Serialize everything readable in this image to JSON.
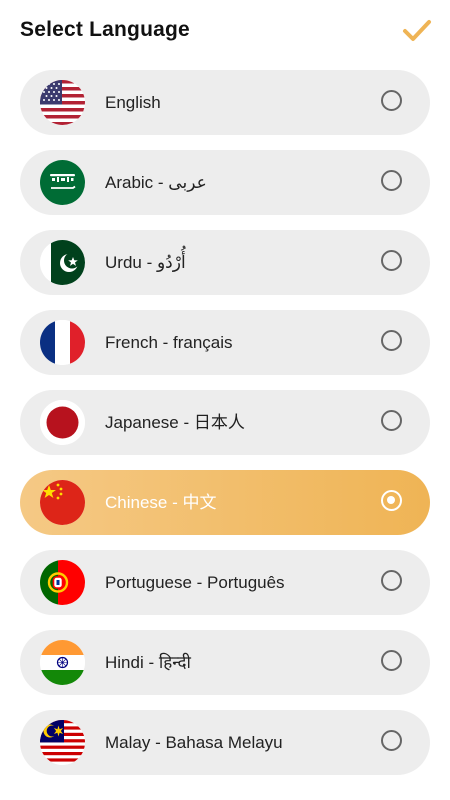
{
  "header": {
    "title": "Select Language",
    "confirm_icon": "checkmark-icon",
    "accent_color": "#efb455"
  },
  "languages": [
    {
      "label": "English",
      "flag": "flag-us-icon",
      "selected": false
    },
    {
      "label": "Arabic - عربى",
      "flag": "flag-saudi-arabia-icon",
      "selected": false
    },
    {
      "label": "Urdu - أُرْدُو",
      "flag": "flag-pakistan-icon",
      "selected": false
    },
    {
      "label": "French - français",
      "flag": "flag-france-icon",
      "selected": false
    },
    {
      "label": "Japanese - 日本人",
      "flag": "flag-japan-icon",
      "selected": false
    },
    {
      "label": "Chinese - 中文",
      "flag": "flag-china-icon",
      "selected": true
    },
    {
      "label": "Portuguese - Português",
      "flag": "flag-portugal-icon",
      "selected": false
    },
    {
      "label": "Hindi - हिन्दी",
      "flag": "flag-india-icon",
      "selected": false
    },
    {
      "label": "Malay - Bahasa Melayu",
      "flag": "flag-malaysia-icon",
      "selected": false
    }
  ]
}
